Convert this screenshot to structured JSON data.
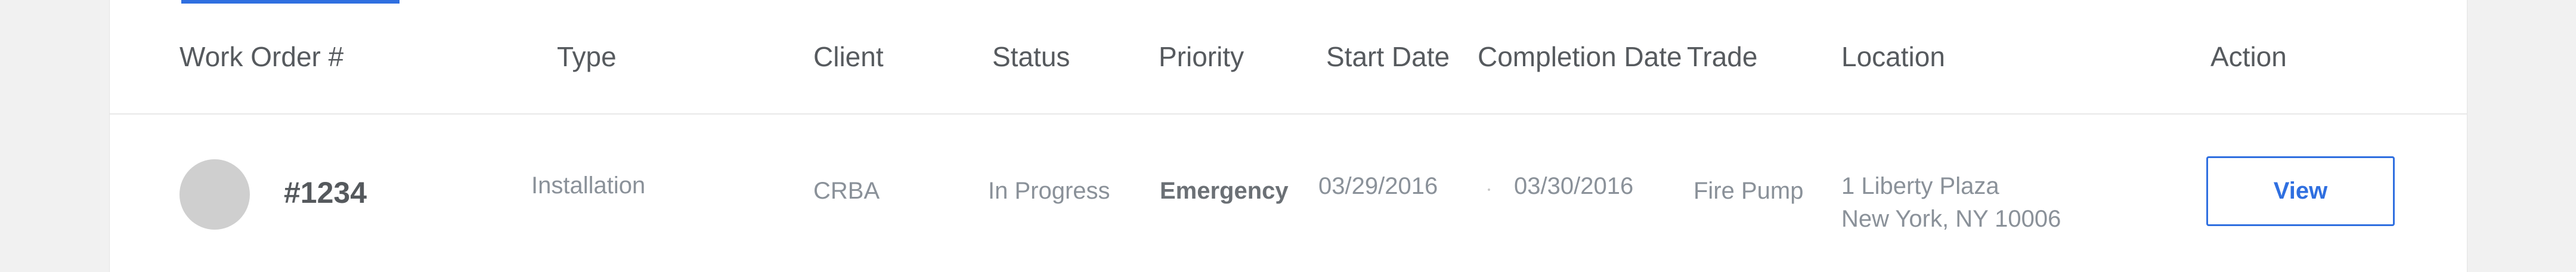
{
  "table": {
    "columns": [
      "Work Order #",
      "Type",
      "Client",
      "Status",
      "Priority",
      "Start Date",
      "Completion Date",
      "Trade",
      "Location",
      "Action"
    ],
    "rows": [
      {
        "work_order": "#1234",
        "type": "Installation",
        "client": "CRBA",
        "status": "In Progress",
        "priority": "Emergency",
        "start_date": "03/29/2016",
        "completion_date": "03/30/2016",
        "trade": "Fire Pump",
        "location_line1": "1 Liberty Plaza",
        "location_line2": "New York, NY 10006",
        "action_label": "View"
      }
    ]
  },
  "colors": {
    "accent": "#2f6fe0",
    "avatar_placeholder": "#cfcfcf"
  }
}
